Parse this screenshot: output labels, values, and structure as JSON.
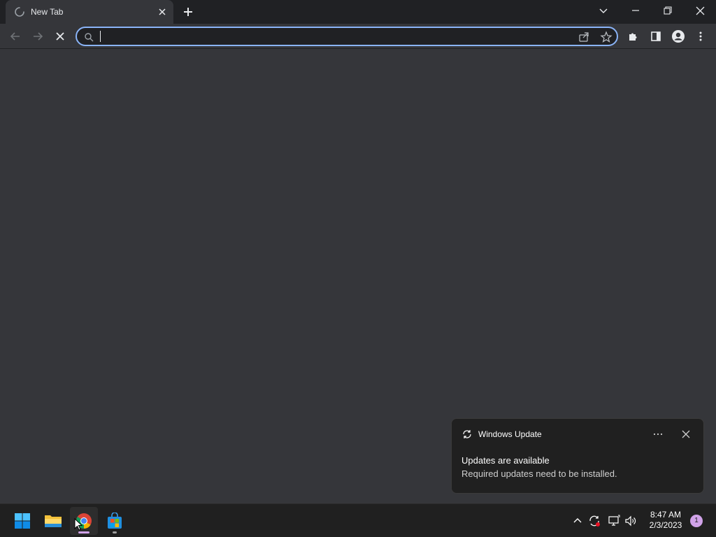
{
  "browser": {
    "tab": {
      "title": "New Tab",
      "loading": true
    },
    "omnibox": {
      "value": "",
      "placeholder": ""
    },
    "accent_color": "#8ab4f8"
  },
  "toast": {
    "app_name": "Windows Update",
    "heading": "Updates are available",
    "body": "Required updates need to be installed."
  },
  "taskbar": {
    "apps": [
      {
        "name": "start",
        "icon": "windows-logo-icon"
      },
      {
        "name": "file-explorer",
        "icon": "folder-icon"
      },
      {
        "name": "chrome",
        "icon": "chrome-icon",
        "active": true
      },
      {
        "name": "microsoft-store",
        "icon": "store-icon"
      }
    ],
    "clock": {
      "time": "8:47 AM",
      "date": "2/3/2023"
    },
    "notification_count": "1"
  }
}
